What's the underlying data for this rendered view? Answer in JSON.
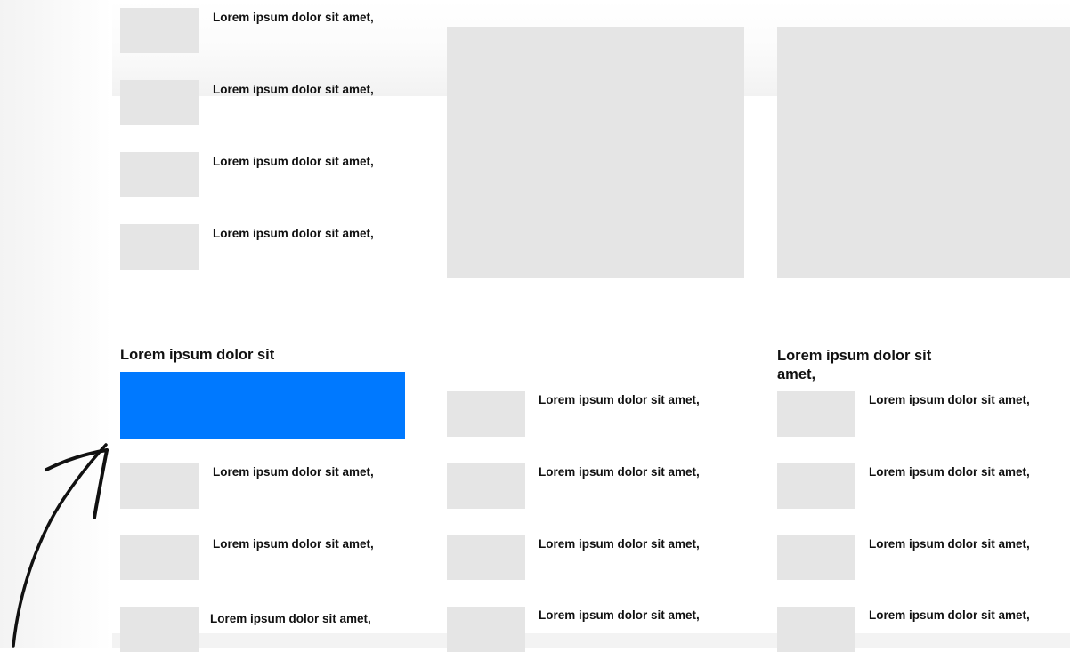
{
  "item_label": "Lorem ipsum dolor sit amet,",
  "left_heading": "Lorem ipsum dolor sit",
  "right_heading": "Lorem ipsum dolor sit amet,",
  "colors": {
    "highlight": "#0079ff",
    "placeholder": "#e5e5e5",
    "arrow": "#111111"
  },
  "icons": [
    "hand-drawn-arrow-icon"
  ]
}
